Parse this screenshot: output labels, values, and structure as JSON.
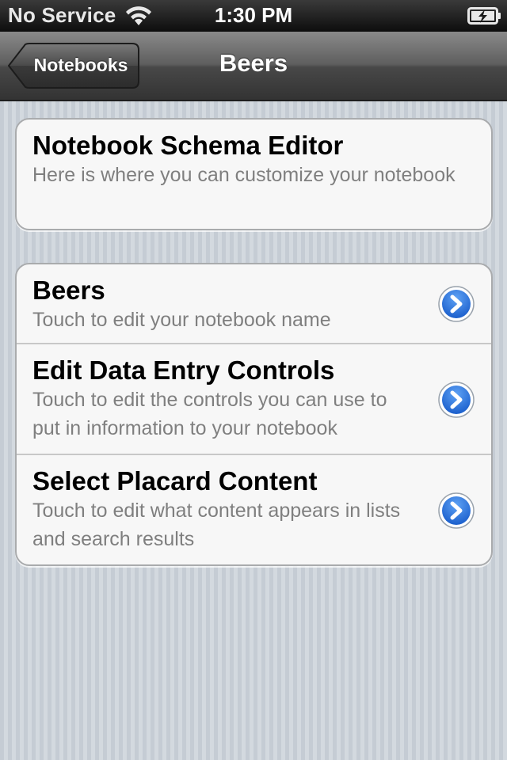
{
  "status_bar": {
    "carrier": "No Service",
    "time": "1:30 PM",
    "wifi_icon": "wifi-icon",
    "battery_icon": "battery-charging-icon"
  },
  "nav": {
    "back_label": "Notebooks",
    "title": "Beers"
  },
  "schema_editor": {
    "title": "Notebook Schema Editor",
    "subtitle": "Here is where you can customize your notebook"
  },
  "items": [
    {
      "title": "Beers",
      "subtitle": "Touch to edit your notebook name",
      "icon": "disclosure-arrow-icon"
    },
    {
      "title": "Edit Data Entry Controls",
      "subtitle": "Touch to edit the controls you can use to put in information to your notebook",
      "icon": "disclosure-arrow-icon"
    },
    {
      "title": "Select Placard Content",
      "subtitle": "Touch to edit what content appears in lists and search results",
      "icon": "disclosure-arrow-icon"
    }
  ],
  "colors": {
    "accent_blue": "#2f6fd0",
    "subtitle_gray": "#7f7f7f",
    "nav_bar": "#4a4a4a"
  }
}
